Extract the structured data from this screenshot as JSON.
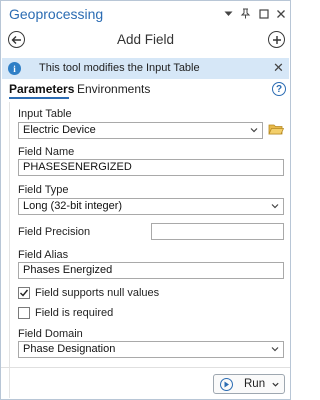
{
  "window": {
    "title": "Geoprocessing",
    "controls": [
      "chevron-down-icon",
      "pin-icon",
      "maximize-icon",
      "close-icon"
    ]
  },
  "tool": {
    "title": "Add Field",
    "back_icon": "back-arrow-icon",
    "add_icon": "add-plus-icon"
  },
  "info": {
    "message": "This tool modifies the Input Table",
    "icon": "info-icon",
    "close_glyph": "✕"
  },
  "tabs": [
    {
      "label": "Parameters",
      "active": true
    },
    {
      "label": "Environments",
      "active": false
    }
  ],
  "help_glyph": "?",
  "params": {
    "input_table": {
      "label": "Input Table",
      "value": "Electric Device"
    },
    "field_name": {
      "label": "Field Name",
      "value": "PHASESENERGIZED"
    },
    "field_type": {
      "label": "Field Type",
      "value": "Long (32-bit integer)"
    },
    "field_precision": {
      "label": "Field Precision",
      "value": ""
    },
    "field_alias": {
      "label": "Field Alias",
      "value": "Phases Energized"
    },
    "nullable": {
      "label": "Field supports null values",
      "checked": true
    },
    "required": {
      "label": "Field is required",
      "checked": false
    },
    "field_domain": {
      "label": "Field Domain",
      "value": "Phase Designation"
    }
  },
  "run": {
    "label": "Run"
  },
  "colors": {
    "accent": "#2b6cb3",
    "info_bar": "#d6e7f7",
    "folder": "#e8b94a"
  }
}
